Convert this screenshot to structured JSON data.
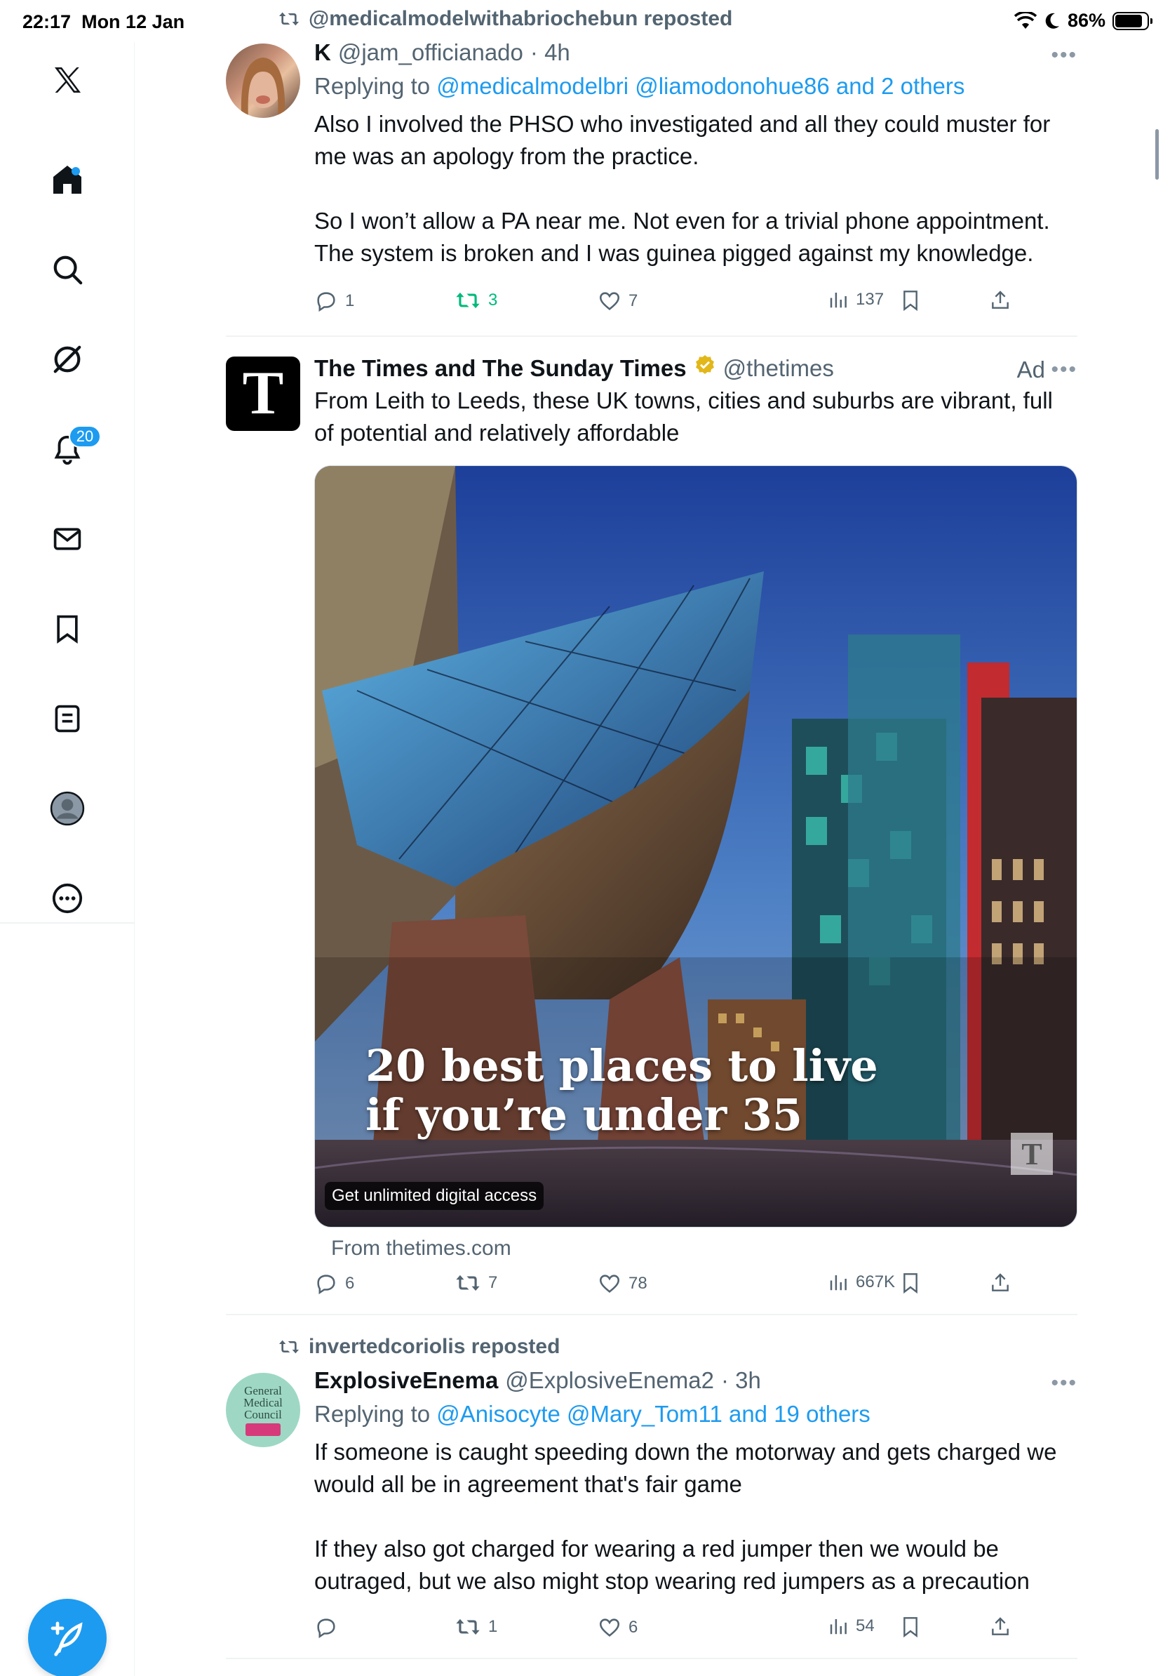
{
  "status": {
    "time": "22:17",
    "date": "Mon 12 Jan",
    "battery": "86%"
  },
  "sidebar": {
    "notifications_badge": "20"
  },
  "tweets": [
    {
      "repost_by": "@medicalmodelwithabriochebun reposted",
      "name": "K",
      "handle": "@jam_officianado",
      "time": "· 4h",
      "replying_prefix": "Replying to",
      "replying_links": "@medicalmodelbri @liamodonohue86 and 2 others",
      "text": "Also I involved the PHSO who investigated and all they could muster for me was an apology from the practice.\n\nSo I won’t allow a PA near me. Not even for a trivial phone appointment. The system is broken and I was guinea pigged against my knowledge.",
      "replies": "1",
      "reposts": "3",
      "likes": "7",
      "views": "137"
    },
    {
      "name": "The Times and The Sunday Times",
      "handle": "@thetimes",
      "ad_label": "Ad",
      "avatar_letter": "T",
      "text": "From Leith to Leeds, these UK towns, cities and suburbs are vibrant, full of potential and relatively affordable",
      "media_title_line1": "20 best places to live",
      "media_title_line2": "if you’re under 35",
      "media_chip": "Get unlimited digital access",
      "media_logo": "T",
      "from": "From thetimes.com",
      "replies": "6",
      "reposts": "7",
      "likes": "78",
      "views": "667K"
    },
    {
      "repost_by": "invertedcoriolis reposted",
      "name": "ExplosiveEnema",
      "handle": "@ExplosiveEnema2",
      "time": "· 3h",
      "replying_prefix": "Replying to",
      "replying_links": "@Anisocyte @Mary_Tom11 and 19 others",
      "avatar_text_1": "General",
      "avatar_text_2": "Medical",
      "avatar_text_3": "Council",
      "text": "If someone is caught speeding down the motorway and gets charged we would all be in agreement that's fair game\n\nIf they also got charged for wearing a red jumper then we would be outraged, but we also might stop wearing red jumpers as a precaution",
      "replies": "",
      "reposts": "1",
      "likes": "6",
      "views": "54"
    }
  ],
  "colors": {
    "accent": "#1d9bf0",
    "secondary_text": "#536471",
    "repost_green": "#00ba7c",
    "divider": "#eff3f4"
  }
}
